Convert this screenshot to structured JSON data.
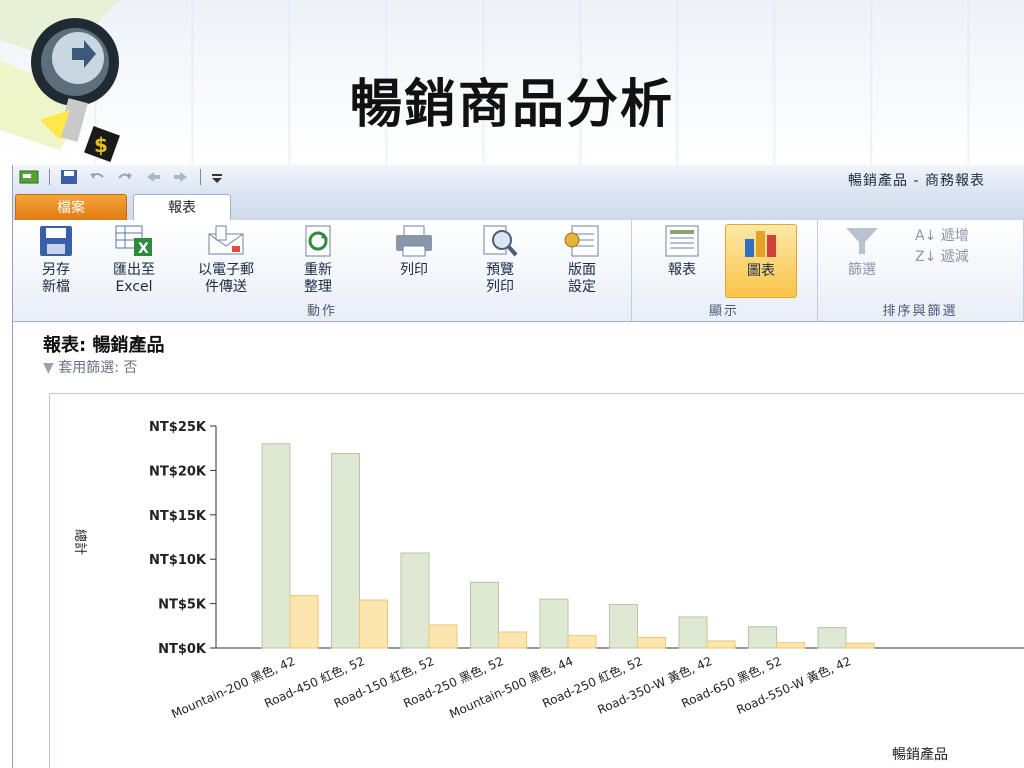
{
  "slide": {
    "title": "暢銷商品分析"
  },
  "window": {
    "title": "暢銷產品 - 商務報表"
  },
  "tabs": [
    {
      "label": "檔案"
    },
    {
      "label": "報表"
    }
  ],
  "ribbon": {
    "groups": {
      "actions": {
        "label": "動作",
        "buttons": [
          {
            "line1": "另存",
            "line2": "新檔",
            "icon": "save-icon"
          },
          {
            "line1": "匯出至",
            "line2": "Excel",
            "icon": "excel-export-icon"
          },
          {
            "line1": "以電子郵",
            "line2": "件傳送",
            "icon": "email-icon"
          },
          {
            "line1": "重新",
            "line2": "整理",
            "icon": "refresh-icon"
          },
          {
            "line1": "列印",
            "line2": "",
            "icon": "printer-icon"
          },
          {
            "line1": "預覽",
            "line2": "列印",
            "icon": "print-preview-icon"
          },
          {
            "line1": "版面",
            "line2": "設定",
            "icon": "page-setup-icon"
          }
        ]
      },
      "display": {
        "label": "顯示",
        "buttons": [
          {
            "line1": "報表",
            "icon": "report-icon"
          },
          {
            "line1": "圖表",
            "icon": "chart-icon",
            "active": true
          }
        ]
      },
      "sort": {
        "label": "排序與篩選",
        "filter": "篩選",
        "asc": "遞增",
        "desc": "遞減"
      }
    }
  },
  "report": {
    "title": "報表: 暢銷產品",
    "filter": "套用篩選: 否"
  },
  "chart_data": {
    "type": "bar",
    "ylabel": "總計",
    "xlabel": "暢銷產品",
    "ylim": [
      0,
      25000
    ],
    "yticks": [
      "NT$0K",
      "NT$5K",
      "NT$10K",
      "NT$15K",
      "NT$20K",
      "NT$25K"
    ],
    "categories": [
      "Mountain-200 黑色, 42",
      "Road-450 紅色, 52",
      "Road-150 紅色, 52",
      "Road-250 黑色, 52",
      "Mountain-500 黑色, 44",
      "Road-250 紅色, 52",
      "Road-350-W 黃色, 42",
      "Road-650 黑色, 52",
      "Road-550-W 黃色, 42"
    ],
    "series": [
      {
        "values": [
          23000,
          21900,
          10700,
          7400,
          5500,
          4900,
          3500,
          2400,
          2300
        ],
        "color": "#dfe8d2"
      },
      {
        "values": [
          5900,
          5400,
          2600,
          1800,
          1400,
          1200,
          800,
          600,
          550
        ],
        "color": "#fde6ad"
      }
    ],
    "grid": true
  }
}
